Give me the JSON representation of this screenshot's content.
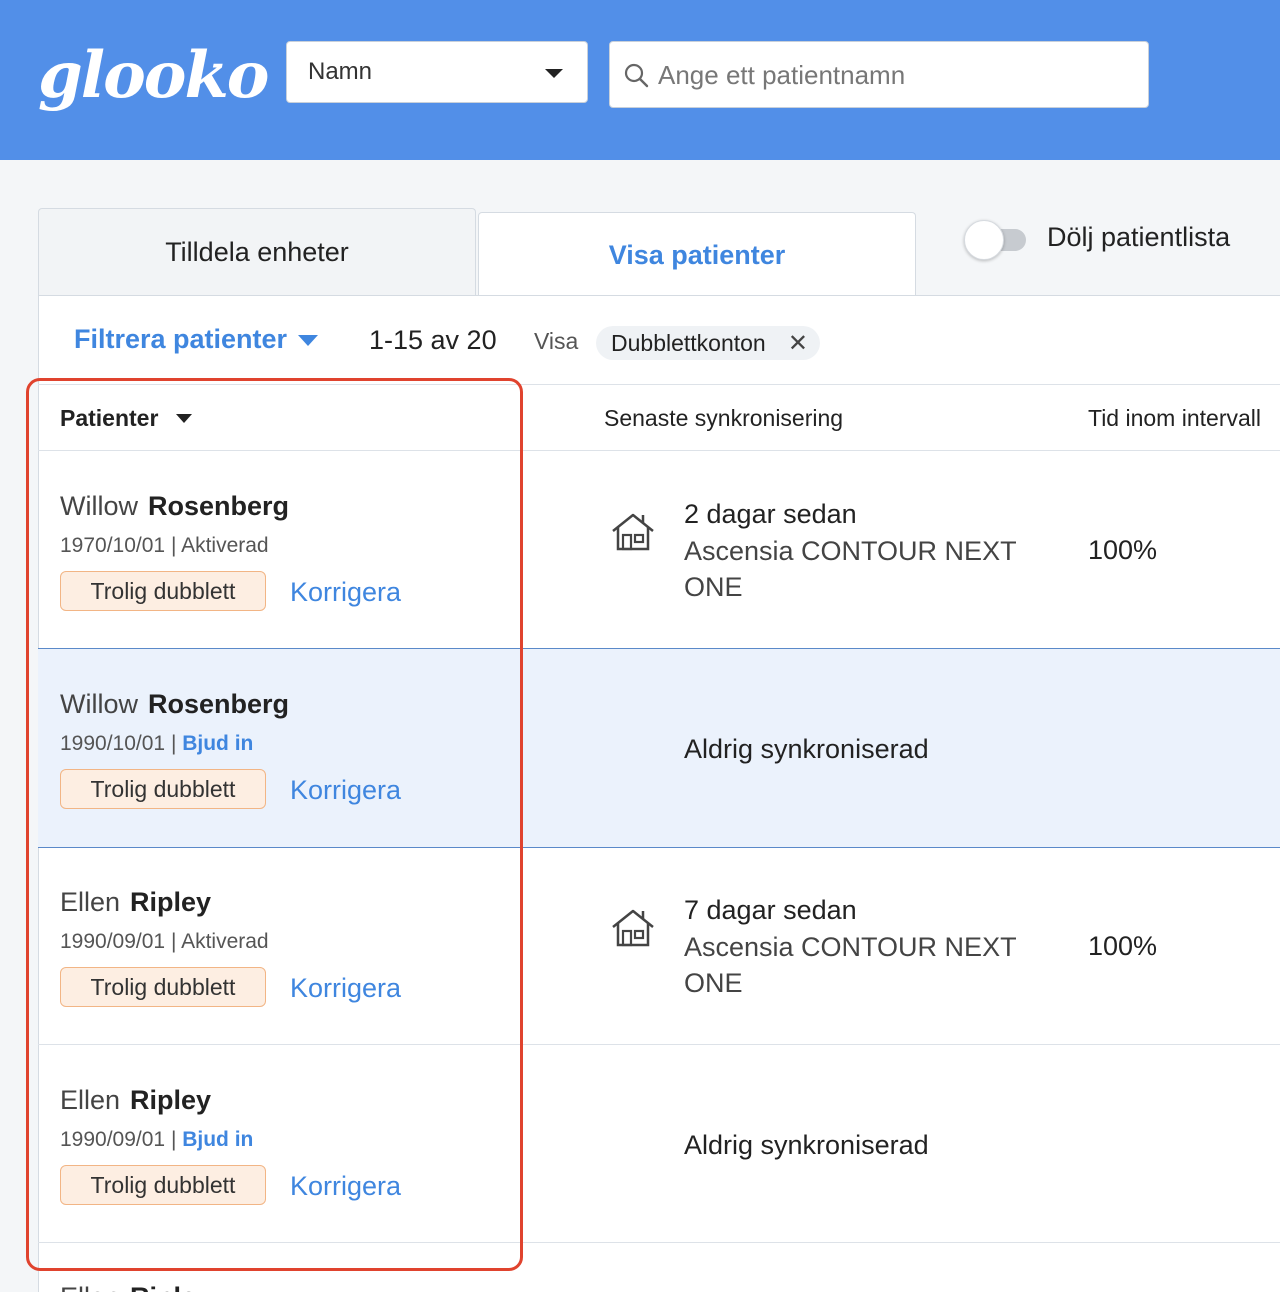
{
  "header": {
    "logo_text": "glooko",
    "search_type": {
      "selected": "Namn"
    },
    "search": {
      "placeholder": "Ange ett patientnamn"
    }
  },
  "tabs": [
    {
      "label": "Tilldela enheter",
      "active": false
    },
    {
      "label": "Visa patienter",
      "active": true
    }
  ],
  "toggle": {
    "label": "Dölj patientlista",
    "on": false
  },
  "toolbar": {
    "filter_label": "Filtrera patienter",
    "range": "1-15 av 20",
    "show_label": "Visa",
    "chip_label": "Dubblettkonton"
  },
  "table": {
    "columns": [
      "Patienter",
      "Senaste synkronisering",
      "Tid inom intervall"
    ],
    "rows": [
      {
        "first": "Willow",
        "last": "Rosenberg",
        "dob": "1970/10/01",
        "status": "Aktiverad",
        "badge": "Trolig dubblett",
        "action": "Korrigera",
        "sync_time": "2 dagar sedan",
        "sync_device": "Ascensia CONTOUR NEXT ONE",
        "tir": "100%"
      },
      {
        "first": "Willow",
        "last": "Rosenberg",
        "dob": "1990/10/01",
        "status": "Bjud in",
        "badge": "Trolig dubblett",
        "action": "Korrigera",
        "sync_never": "Aldrig synkroniserad"
      },
      {
        "first": "Ellen",
        "last": "Ripley",
        "dob": "1990/09/01",
        "status": "Aktiverad",
        "badge": "Trolig dubblett",
        "action": "Korrigera",
        "sync_time": "7 dagar sedan",
        "sync_device": "Ascensia CONTOUR NEXT ONE",
        "tir": "100%"
      },
      {
        "first": "Ellen",
        "last": "Ripley",
        "dob": "1990/09/01",
        "status": "Bjud in",
        "badge": "Trolig dubblett",
        "action": "Korrigera",
        "sync_never": "Aldrig synkroniserad"
      },
      {
        "first": "Ellen",
        "last": "Ripley"
      }
    ]
  },
  "colors": {
    "header_bg": "#528fe8",
    "link_blue": "#3f86df",
    "badge_bg": "#fdeee2",
    "badge_border": "#f2b585",
    "highlight_row": "#ebf2fc",
    "annotation_red": "#e0432e"
  },
  "icons": {
    "search": "search-icon",
    "home": "home-icon",
    "close": "close-icon"
  }
}
